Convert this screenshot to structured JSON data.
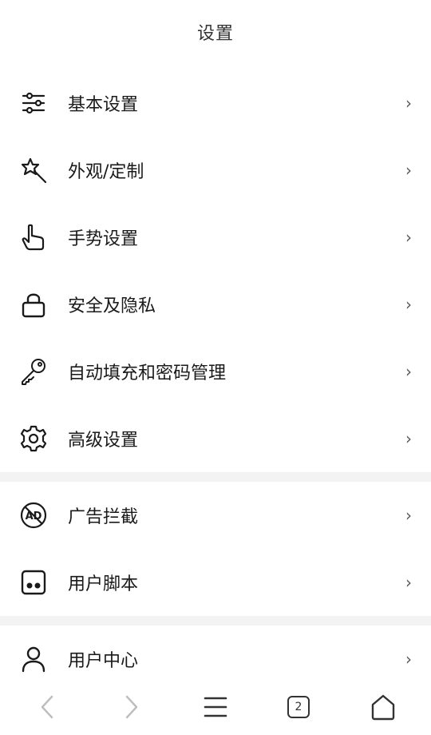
{
  "header": {
    "title": "设置"
  },
  "groups": [
    {
      "items": [
        {
          "label": "基本设置",
          "icon": "sliders-icon"
        },
        {
          "label": "外观/定制",
          "icon": "magic-wand-icon"
        },
        {
          "label": "手势设置",
          "icon": "hand-pointer-icon"
        },
        {
          "label": "安全及隐私",
          "icon": "lock-icon"
        },
        {
          "label": "自动填充和密码管理",
          "icon": "key-icon"
        },
        {
          "label": "高级设置",
          "icon": "gear-icon"
        }
      ]
    },
    {
      "items": [
        {
          "label": "广告拦截",
          "icon": "ad-block-icon"
        },
        {
          "label": "用户脚本",
          "icon": "script-icon"
        }
      ]
    },
    {
      "items": [
        {
          "label": "用户中心",
          "icon": "user-icon"
        }
      ]
    }
  ],
  "chevron": "›",
  "bottom_bar": {
    "tab_count": "2",
    "icons": [
      "back-icon",
      "forward-icon",
      "menu-icon",
      "tabs-icon",
      "home-icon"
    ]
  }
}
